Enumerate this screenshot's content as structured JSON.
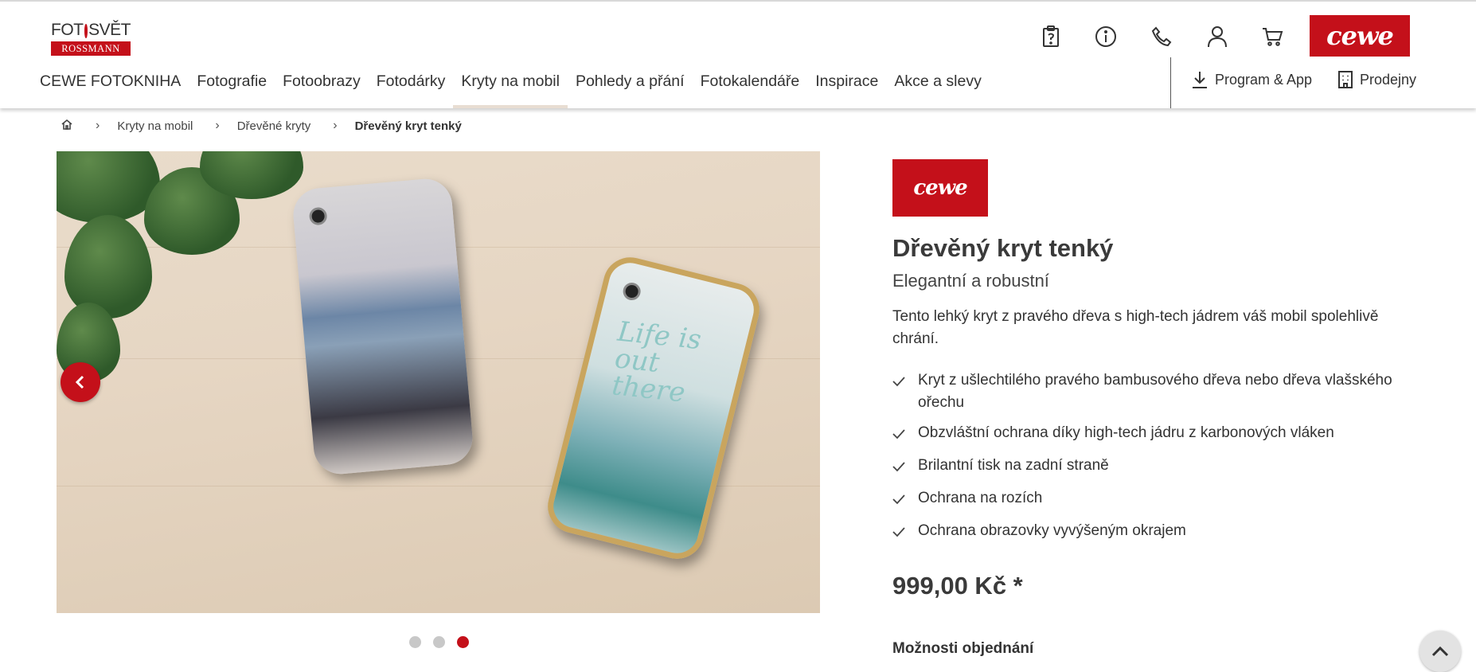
{
  "brand": {
    "logo_top": "FOTOSVĚT",
    "logo_bottom": "ROSSMANN",
    "cewe_label": "cewe"
  },
  "colors": {
    "accent": "#c4101a",
    "nav_active_underline": "#e8ddd2"
  },
  "top_icons": [
    "clipboard-icon",
    "info-icon",
    "phone-icon",
    "user-icon",
    "cart-icon"
  ],
  "nav": {
    "items": [
      "CEWE FOTOKNIHA",
      "Fotografie",
      "Fotoobrazy",
      "Fotodárky",
      "Kryty na mobil",
      "Pohledy a přání",
      "Fotokalendáře",
      "Inspirace",
      "Akce a slevy"
    ],
    "active": "Kryty na mobil",
    "program_app": "Program & App",
    "stores": "Prodejny"
  },
  "breadcrumb": {
    "home_icon": "home-icon",
    "items": [
      "Kryty na mobil",
      "Dřevěné kryty",
      "Dřevěný kryt tenký"
    ]
  },
  "gallery": {
    "photo_caption_text": "Life is out there",
    "dots_count": 3,
    "active_dot": 3
  },
  "product": {
    "title": "Dřevěný kryt tenký",
    "subtitle": "Elegantní a robustní",
    "description": "Tento lehký kryt z pravého dřeva s high-tech jádrem váš mobil spolehlivě chrání.",
    "features": [
      "Kryt z ušlechtilého pravého bambusového dřeva nebo dřeva vlašského ořechu",
      "Obzvláštní ochrana díky high-tech jádru z karbonových vláken",
      "Brilantní tisk na zadní straně",
      "Ochrana na rozích",
      "Ochrana obrazovky vyvýšeným okrajem"
    ],
    "price": "999,00 Kč *",
    "options_heading": "Možnosti objednání"
  }
}
